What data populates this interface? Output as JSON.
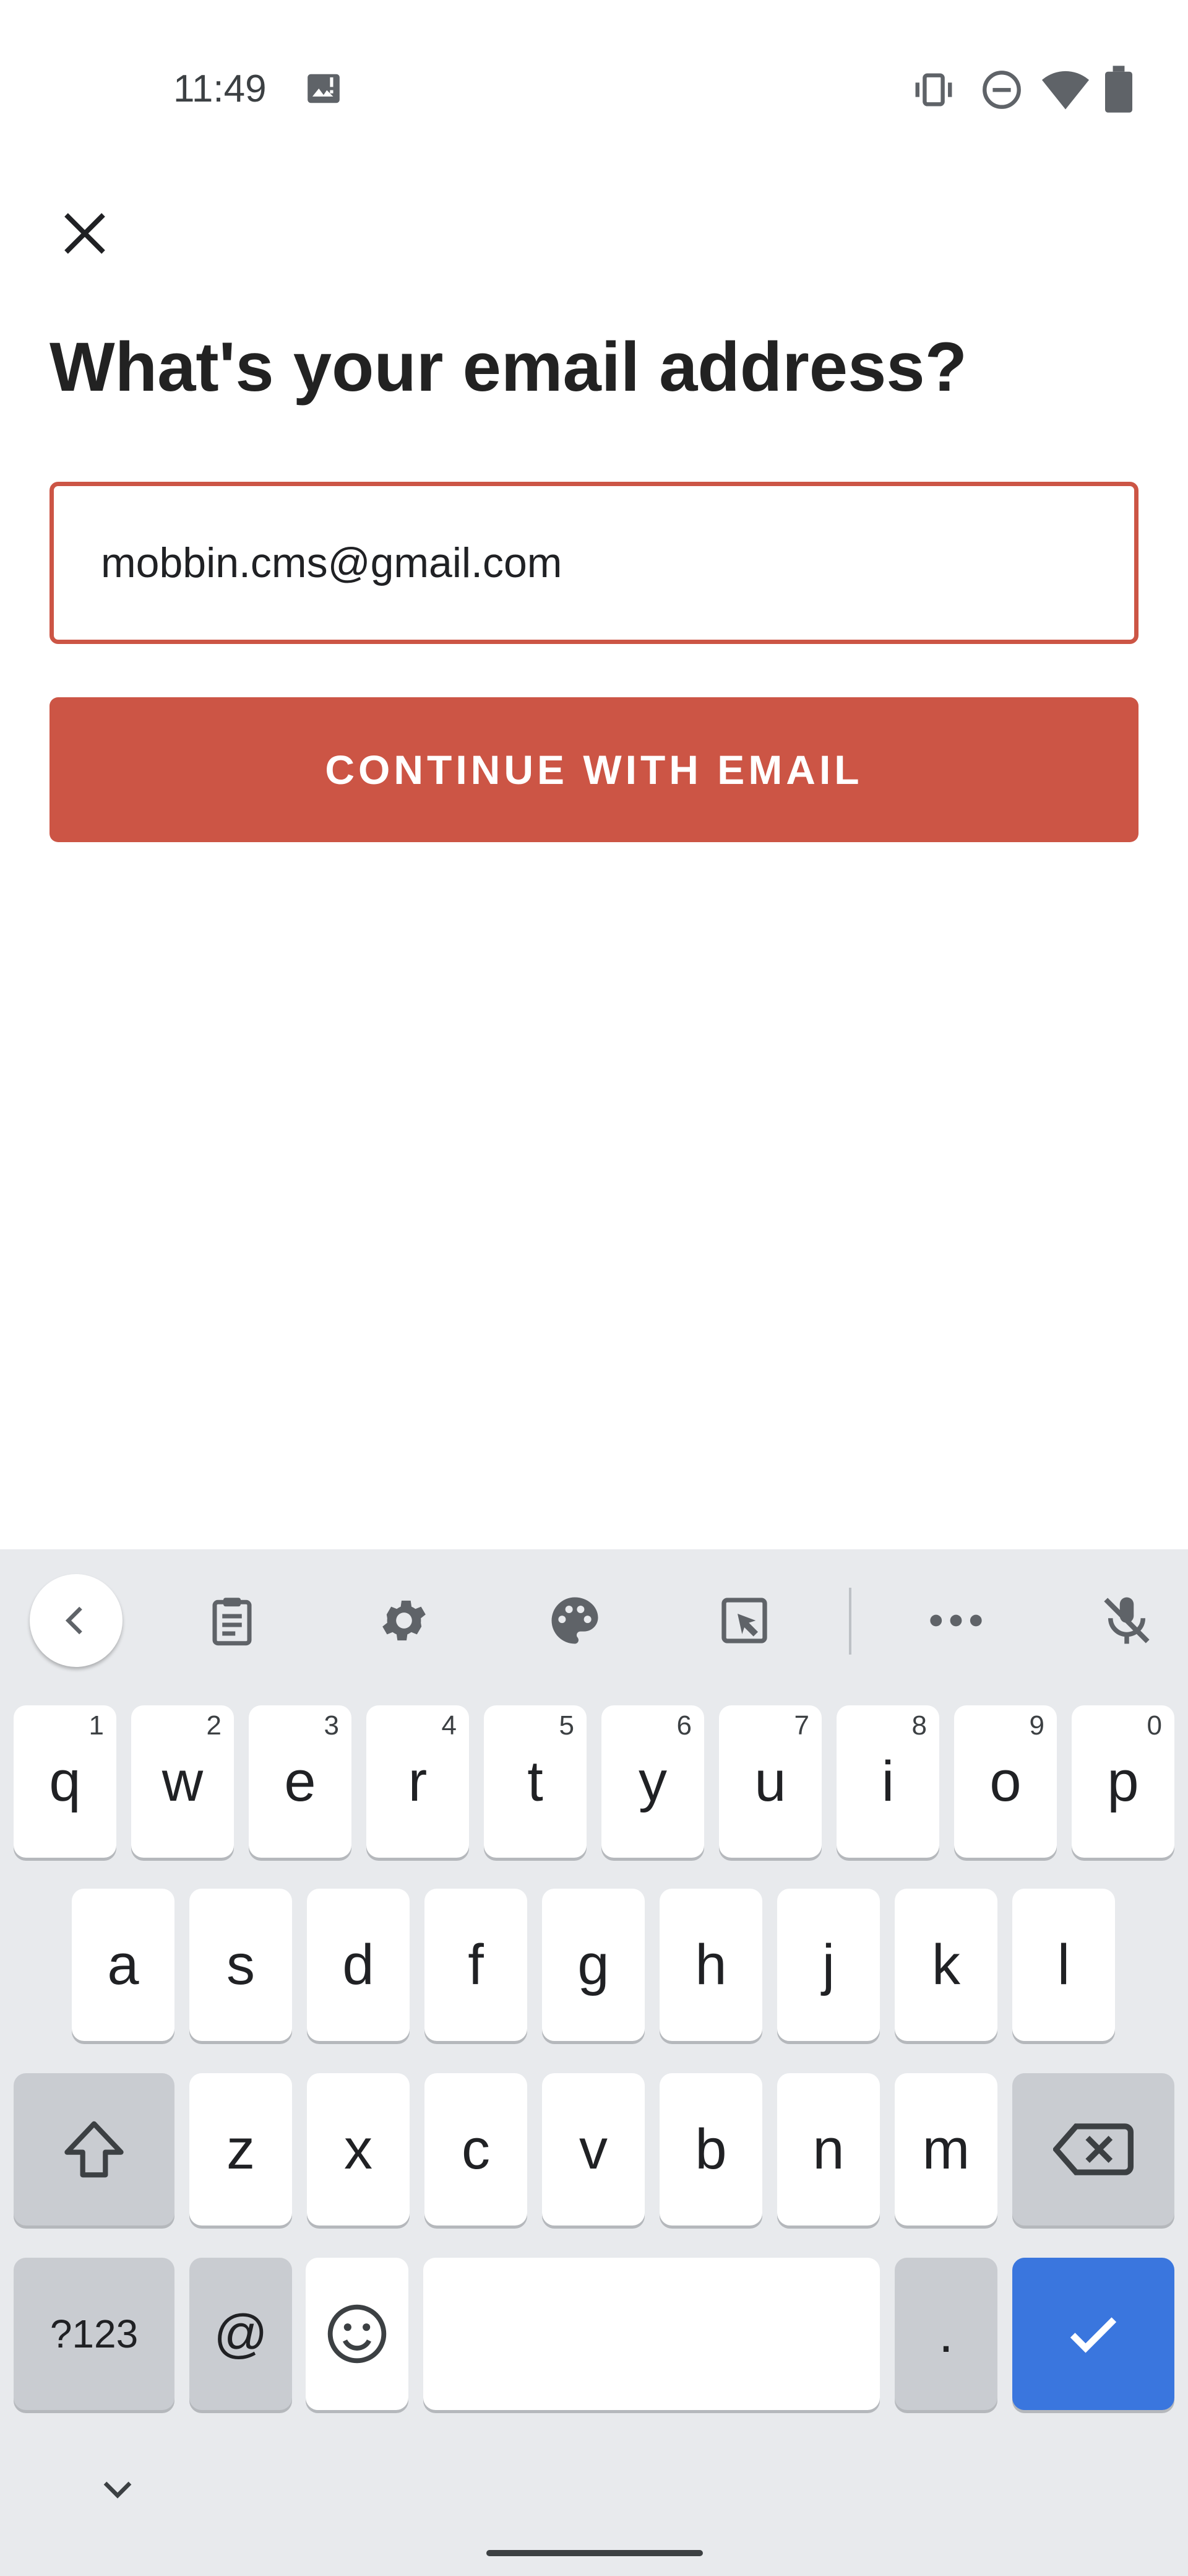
{
  "status_bar": {
    "time": "11:49",
    "icons": [
      "image-notification-icon",
      "vibrate-icon",
      "do-not-disturb-icon",
      "wifi-icon",
      "battery-icon"
    ]
  },
  "page": {
    "title": "What's your email address?",
    "email_value": "mobbin.cms@gmail.com",
    "continue_label": "CONTINUE WITH EMAIL",
    "accent_color": "#cc5545"
  },
  "keyboard": {
    "toolbar": [
      "back-chevron-icon",
      "clipboard-icon",
      "gear-icon",
      "palette-icon",
      "one-handed-mode-icon",
      "more-icon",
      "mic-off-icon"
    ],
    "row1": [
      {
        "label": "q",
        "hint": "1"
      },
      {
        "label": "w",
        "hint": "2"
      },
      {
        "label": "e",
        "hint": "3"
      },
      {
        "label": "r",
        "hint": "4"
      },
      {
        "label": "t",
        "hint": "5"
      },
      {
        "label": "y",
        "hint": "6"
      },
      {
        "label": "u",
        "hint": "7"
      },
      {
        "label": "i",
        "hint": "8"
      },
      {
        "label": "o",
        "hint": "9"
      },
      {
        "label": "p",
        "hint": "0"
      }
    ],
    "row2": [
      "a",
      "s",
      "d",
      "f",
      "g",
      "h",
      "j",
      "k",
      "l"
    ],
    "row3": [
      "z",
      "x",
      "c",
      "v",
      "b",
      "n",
      "m"
    ],
    "symbols_label": "?123",
    "at_label": "@",
    "period_label": ".",
    "enter_color": "#3a76de"
  }
}
